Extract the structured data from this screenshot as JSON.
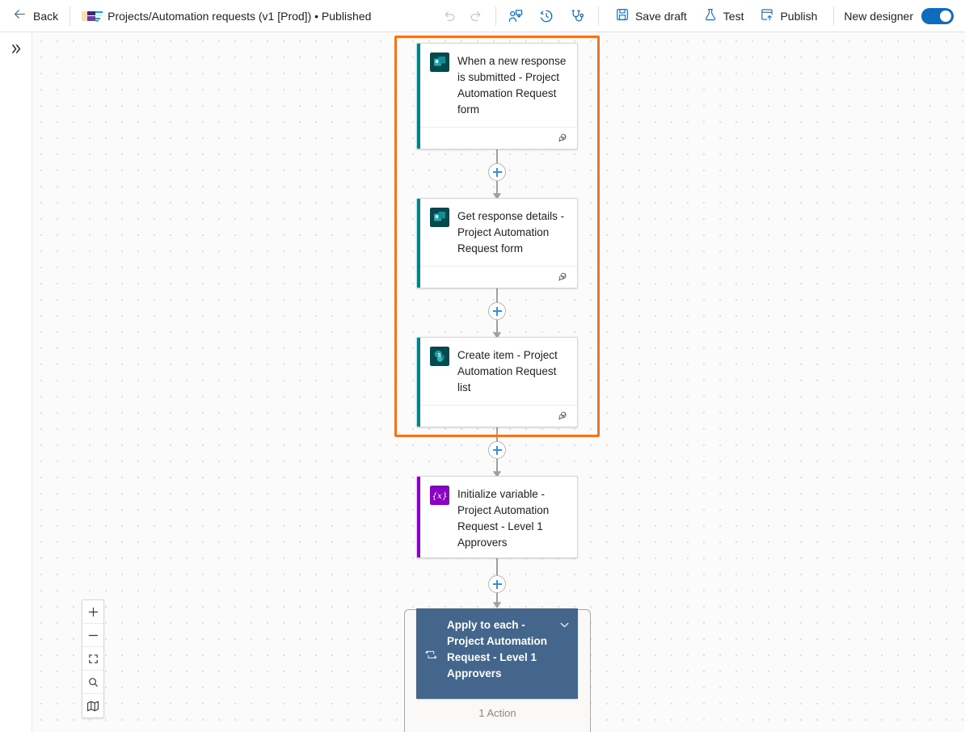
{
  "topbar": {
    "back_label": "Back",
    "title": "Projects/Automation requests (v1 [Prod]) • Published",
    "undo_icon": "undo-icon",
    "redo_icon": "redo-icon",
    "assign_icon": "assign-run-icon",
    "history_icon": "run-history-icon",
    "checker_icon": "flow-checker-icon",
    "save_label": "Save draft",
    "save_icon": "save-icon",
    "test_label": "Test",
    "test_icon": "flask-icon",
    "publish_label": "Publish",
    "publish_icon": "publish-icon",
    "new_designer_label": "New designer",
    "new_designer_on": true
  },
  "left_rail": {
    "expand_icon": "double-chevron-right-icon",
    "expand_label": "»"
  },
  "canvas": {
    "selection_color": "#f2741f",
    "grid_dot_color": "#dedede"
  },
  "nodes": [
    {
      "id": "trigger-forms",
      "title": "When a new response is submitted - Project Automation Request form",
      "icon": "microsoft-forms-icon",
      "accent_color": "#038387",
      "has_comment_icon": true,
      "selected": true
    },
    {
      "id": "get-response-details",
      "title": "Get response details - Project Automation Request form",
      "icon": "microsoft-forms-icon",
      "accent_color": "#038387",
      "has_comment_icon": true,
      "selected": true
    },
    {
      "id": "create-item-sharepoint",
      "title": "Create item - Project Automation Request list",
      "icon": "sharepoint-icon",
      "accent_color": "#038387",
      "has_comment_icon": true,
      "selected": true
    },
    {
      "id": "initialize-variable",
      "title": "Initialize variable - Project Automation Request - Level 1 Approvers",
      "icon": "variable-icon",
      "accent_color": "#8a00c4",
      "has_comment_icon": false,
      "selected": false
    }
  ],
  "scope": {
    "id": "apply-to-each",
    "title": "Apply to each - Project Automation Request - Level 1 Approvers",
    "icon": "loop-icon",
    "chevron": "chevron-down-icon",
    "header_color": "#44658c",
    "action_count_label": "1 Action",
    "collapsed": false
  },
  "add_buttons": [
    {
      "id": "add-step-1",
      "label": "+"
    },
    {
      "id": "add-step-2",
      "label": "+"
    },
    {
      "id": "add-step-3",
      "label": "+"
    },
    {
      "id": "add-step-4",
      "label": "+"
    }
  ],
  "zoom_controls": [
    {
      "id": "zoom-in",
      "icon": "plus-icon"
    },
    {
      "id": "zoom-out",
      "icon": "minus-icon"
    },
    {
      "id": "fit-to-screen",
      "icon": "fit-screen-icon"
    },
    {
      "id": "zoom-search",
      "icon": "magnifier-icon"
    },
    {
      "id": "minimap",
      "icon": "map-icon"
    }
  ]
}
